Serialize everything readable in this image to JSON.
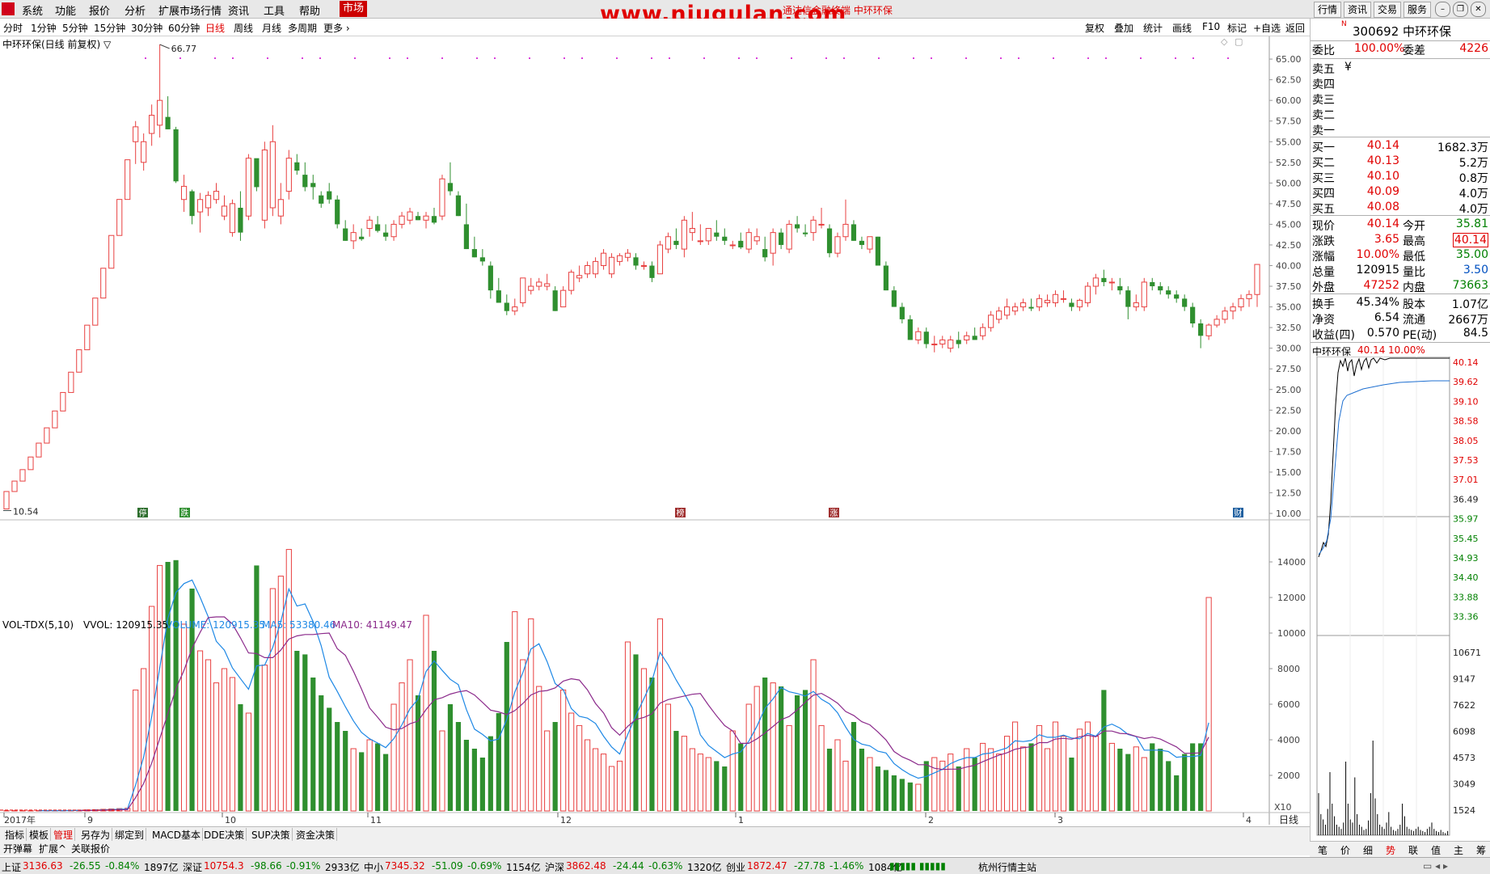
{
  "menu": {
    "items": [
      "系统",
      "功能",
      "报价",
      "分析",
      "扩展市场行情",
      "资讯",
      "工具",
      "帮助"
    ],
    "market_tab": "市场",
    "watermark": "www.niugulan.com",
    "ticker_overlay": "通达信金融终端 中环环保",
    "right_buttons": [
      "行情",
      "资讯",
      "交易",
      "服务"
    ]
  },
  "periods": {
    "items": [
      "分时",
      "1分钟",
      "5分钟",
      "15分钟",
      "30分钟",
      "60分钟",
      "日线",
      "周线",
      "月线",
      "多周期",
      "更多"
    ],
    "selected": "日线",
    "right_items": [
      "复权",
      "叠加",
      "统计",
      "画线",
      "F10",
      "标记",
      "+自选",
      "返回"
    ]
  },
  "chart": {
    "title": "中环环保(日线 前复权) ▽",
    "max_label": "66.77",
    "min_label": "10.54",
    "price_ticks": [
      "65.00",
      "62.50",
      "60.00",
      "57.50",
      "55.00",
      "52.50",
      "50.00",
      "47.50",
      "45.00",
      "42.50",
      "40.00",
      "37.50",
      "35.00",
      "32.50",
      "30.00",
      "27.50",
      "25.00",
      "22.50",
      "20.00",
      "17.50",
      "15.00",
      "12.50",
      "10.00"
    ],
    "event_markers": [
      "停",
      "跌",
      "榜",
      "涨",
      "财"
    ],
    "vol_header": {
      "name": "VOL-TDX(5,10)",
      "vvol": "VVOL: 120915.35",
      "volume": "VOLUME: 120915.35",
      "ma5": "MA5: 53380.46",
      "ma10": "MA10: 41149.47"
    },
    "vol_ticks": [
      "14000",
      "12000",
      "10000",
      "8000",
      "6000",
      "4000",
      "2000"
    ],
    "vol_unit": "X10",
    "date_labels": [
      "2017年",
      "9",
      "10",
      "11",
      "12",
      "1",
      "2",
      "3",
      "4"
    ],
    "period_label": "日线",
    "colors": {
      "up": "#e84040",
      "down": "#2f8f2f",
      "ma5": "#1e88e5",
      "ma10": "#8b2a8b"
    }
  },
  "chart_data": {
    "type": "candlestick",
    "ylim": [
      10.0,
      66.77
    ],
    "candles": [
      [
        10.54,
        12.0,
        10.54,
        12.65
      ],
      [
        12.65,
        13.91,
        12.65,
        13.91
      ],
      [
        13.91,
        15.3,
        13.91,
        15.3
      ],
      [
        15.3,
        16.83,
        15.3,
        16.83
      ],
      [
        16.83,
        18.51,
        16.83,
        18.51
      ],
      [
        18.51,
        20.36,
        18.51,
        20.36
      ],
      [
        20.36,
        22.4,
        20.36,
        22.4
      ],
      [
        22.4,
        24.64,
        22.4,
        24.64
      ],
      [
        24.64,
        27.1,
        24.64,
        27.1
      ],
      [
        27.1,
        29.81,
        27.1,
        29.81
      ],
      [
        29.81,
        32.79,
        29.81,
        32.79
      ],
      [
        32.79,
        36.07,
        32.79,
        36.07
      ],
      [
        36.07,
        39.68,
        36.07,
        39.68
      ],
      [
        39.68,
        43.65,
        39.68,
        43.65
      ],
      [
        43.65,
        48.01,
        43.65,
        48.01
      ],
      [
        48.01,
        52.81,
        48.01,
        52.81
      ],
      [
        55.0,
        57.5,
        52.3,
        56.8
      ],
      [
        52.5,
        56.0,
        51.5,
        55.0
      ],
      [
        56.0,
        59.5,
        54.5,
        58.2
      ],
      [
        57.0,
        66.77,
        55.5,
        60.0
      ],
      [
        58.0,
        60.5,
        56.5,
        56.5
      ],
      [
        56.5,
        56.8,
        50.0,
        50.2
      ],
      [
        48.0,
        51.0,
        46.5,
        49.6
      ],
      [
        49.0,
        49.2,
        45.0,
        46.0
      ],
      [
        46.5,
        48.8,
        44.0,
        48.0
      ],
      [
        47.0,
        49.0,
        46.0,
        48.5
      ],
      [
        48.0,
        50.0,
        47.5,
        49.0
      ],
      [
        46.0,
        48.5,
        45.5,
        47.2
      ],
      [
        44.0,
        48.0,
        43.5,
        47.5
      ],
      [
        47.0,
        49.0,
        43.0,
        44.0
      ],
      [
        46.0,
        53.5,
        45.5,
        53.0
      ],
      [
        53.0,
        52.5,
        49.0,
        49.5
      ],
      [
        45.5,
        55.0,
        44.5,
        54.0
      ],
      [
        47.0,
        57.0,
        46.0,
        55.0
      ],
      [
        46.0,
        50.0,
        45.0,
        48.0
      ],
      [
        49.0,
        54.0,
        48.0,
        53.0
      ],
      [
        52.5,
        53.5,
        51.0,
        51.5
      ],
      [
        51.0,
        52.5,
        49.0,
        49.5
      ],
      [
        50.0,
        51.0,
        48.0,
        49.5
      ],
      [
        48.5,
        49.0,
        47.0,
        47.5
      ],
      [
        49.0,
        50.0,
        47.5,
        48.0
      ],
      [
        48.0,
        48.5,
        44.5,
        45.0
      ],
      [
        44.5,
        45.5,
        43.0,
        43.0
      ],
      [
        43.0,
        45.0,
        42.0,
        44.0
      ],
      [
        43.5,
        44.5,
        43.0,
        43.2
      ],
      [
        44.5,
        46.0,
        43.5,
        45.5
      ],
      [
        45.0,
        46.0,
        44.0,
        44.2
      ],
      [
        44.0,
        45.0,
        43.0,
        43.5
      ],
      [
        43.5,
        45.5,
        43.0,
        45.0
      ],
      [
        45.0,
        46.5,
        44.5,
        46.0
      ],
      [
        45.5,
        47.0,
        45.0,
        46.5
      ],
      [
        46.0,
        46.5,
        45.5,
        45.5
      ],
      [
        45.5,
        46.5,
        44.5,
        46.0
      ],
      [
        46.0,
        47.0,
        45.0,
        45.2
      ],
      [
        46.0,
        51.0,
        45.5,
        50.5
      ],
      [
        50.0,
        52.5,
        48.5,
        49.0
      ],
      [
        48.5,
        49.0,
        46.0,
        46.0
      ],
      [
        45.0,
        47.5,
        42.0,
        42.0
      ],
      [
        42.0,
        43.5,
        41.0,
        41.0
      ],
      [
        41.0,
        42.0,
        40.0,
        40.5
      ],
      [
        40.0,
        40.5,
        36.0,
        37.0
      ],
      [
        37.0,
        38.5,
        35.5,
        35.5
      ],
      [
        35.5,
        36.5,
        34.0,
        34.5
      ],
      [
        34.5,
        36.0,
        34.0,
        35.0
      ],
      [
        35.5,
        38.5,
        35.0,
        38.5
      ],
      [
        37.0,
        38.5,
        36.5,
        37.5
      ],
      [
        37.5,
        38.5,
        37.0,
        38.0
      ],
      [
        37.5,
        39.0,
        37.0,
        37.8
      ],
      [
        37.0,
        37.5,
        34.5,
        34.5
      ],
      [
        35.0,
        37.5,
        35.0,
        37.0
      ],
      [
        37.0,
        39.5,
        36.5,
        39.2
      ],
      [
        38.5,
        40.0,
        38.0,
        38.8
      ],
      [
        39.0,
        40.5,
        38.5,
        40.0
      ],
      [
        39.0,
        41.0,
        38.5,
        40.5
      ],
      [
        40.0,
        42.0,
        39.5,
        41.5
      ],
      [
        39.0,
        41.5,
        38.5,
        41.0
      ],
      [
        40.5,
        41.5,
        40.0,
        41.2
      ],
      [
        41.0,
        42.0,
        40.5,
        41.5
      ],
      [
        41.0,
        41.5,
        39.5,
        40.0
      ],
      [
        40.0,
        40.5,
        39.5,
        40.0
      ],
      [
        40.0,
        40.5,
        38.0,
        38.5
      ],
      [
        39.0,
        43.0,
        39.0,
        42.5
      ],
      [
        42.0,
        44.0,
        41.5,
        43.5
      ],
      [
        43.0,
        44.5,
        42.0,
        42.5
      ],
      [
        42.0,
        46.0,
        41.0,
        45.5
      ],
      [
        44.0,
        46.5,
        43.0,
        44.5
      ],
      [
        43.0,
        45.0,
        42.5,
        43.0
      ],
      [
        43.0,
        44.5,
        42.5,
        44.5
      ],
      [
        44.0,
        45.5,
        43.0,
        43.5
      ],
      [
        43.5,
        44.5,
        42.5,
        43.0
      ],
      [
        42.5,
        43.0,
        42.0,
        42.5
      ],
      [
        43.0,
        44.0,
        42.0,
        42.2
      ],
      [
        42.0,
        44.5,
        41.5,
        44.0
      ],
      [
        43.0,
        44.5,
        42.5,
        43.5
      ],
      [
        42.0,
        43.5,
        40.5,
        41.0
      ],
      [
        41.5,
        44.5,
        40.0,
        44.0
      ],
      [
        44.0,
        44.5,
        42.0,
        42.5
      ],
      [
        42.0,
        45.5,
        41.5,
        45.0
      ],
      [
        45.0,
        46.0,
        44.0,
        44.5
      ],
      [
        44.0,
        45.0,
        43.5,
        43.8
      ],
      [
        44.0,
        46.0,
        43.0,
        45.5
      ],
      [
        45.0,
        47.0,
        44.5,
        45.0
      ],
      [
        44.5,
        45.0,
        41.0,
        41.5
      ],
      [
        41.5,
        44.0,
        41.0,
        43.5
      ],
      [
        43.5,
        48.0,
        43.0,
        45.0
      ],
      [
        45.0,
        45.5,
        43.0,
        43.0
      ],
      [
        43.0,
        43.5,
        42.0,
        42.5
      ],
      [
        42.0,
        43.5,
        41.5,
        43.5
      ],
      [
        43.5,
        43.5,
        40.0,
        40.0
      ],
      [
        40.0,
        40.5,
        37.0,
        37.0
      ],
      [
        37.0,
        37.5,
        35.0,
        35.0
      ],
      [
        35.0,
        35.5,
        33.0,
        33.5
      ],
      [
        33.5,
        34.0,
        31.0,
        31.0
      ],
      [
        31.0,
        32.5,
        30.5,
        32.0
      ],
      [
        32.0,
        32.5,
        30.0,
        30.5
      ],
      [
        30.5,
        31.5,
        29.5,
        30.5
      ],
      [
        30.5,
        31.5,
        30.0,
        31.0
      ],
      [
        30.0,
        31.5,
        29.5,
        31.0
      ],
      [
        31.0,
        32.0,
        30.0,
        30.5
      ],
      [
        31.0,
        32.0,
        30.5,
        31.5
      ],
      [
        31.5,
        32.5,
        31.0,
        31.0
      ],
      [
        31.5,
        33.0,
        31.0,
        32.5
      ],
      [
        32.5,
        34.5,
        32.0,
        34.0
      ],
      [
        33.5,
        35.0,
        33.0,
        34.5
      ],
      [
        34.0,
        36.0,
        33.5,
        35.0
      ],
      [
        34.5,
        35.5,
        34.0,
        35.0
      ],
      [
        35.0,
        36.0,
        34.5,
        35.5
      ],
      [
        35.0,
        36.0,
        34.5,
        34.8
      ],
      [
        35.0,
        36.5,
        34.5,
        36.0
      ],
      [
        35.5,
        36.5,
        35.0,
        35.8
      ],
      [
        35.5,
        37.0,
        35.0,
        36.5
      ],
      [
        36.0,
        37.0,
        35.5,
        36.0
      ],
      [
        35.5,
        36.0,
        34.5,
        35.0
      ],
      [
        35.0,
        36.0,
        34.5,
        35.8
      ],
      [
        35.5,
        38.0,
        35.0,
        37.5
      ],
      [
        37.5,
        39.0,
        36.5,
        38.5
      ],
      [
        38.5,
        39.5,
        37.5,
        38.0
      ],
      [
        38.0,
        38.5,
        37.0,
        38.0
      ],
      [
        37.5,
        38.5,
        36.5,
        37.0
      ],
      [
        37.0,
        37.5,
        33.5,
        35.0
      ],
      [
        35.0,
        36.5,
        34.5,
        35.5
      ],
      [
        35.0,
        38.5,
        34.5,
        38.0
      ],
      [
        38.0,
        38.5,
        37.0,
        37.5
      ],
      [
        37.5,
        38.0,
        36.5,
        37.0
      ],
      [
        37.0,
        37.5,
        36.0,
        36.5
      ],
      [
        36.5,
        37.0,
        35.5,
        36.0
      ],
      [
        36.0,
        36.5,
        34.5,
        35.0
      ],
      [
        35.0,
        35.5,
        32.5,
        33.0
      ],
      [
        33.0,
        33.5,
        30.0,
        31.5
      ],
      [
        31.5,
        33.0,
        31.0,
        32.8
      ],
      [
        32.8,
        34.0,
        32.5,
        33.5
      ],
      [
        33.5,
        35.0,
        33.0,
        34.5
      ],
      [
        34.5,
        35.5,
        33.5,
        35.0
      ],
      [
        35.0,
        36.5,
        34.5,
        36.0
      ],
      [
        36.0,
        37.0,
        35.0,
        36.5
      ],
      [
        36.5,
        40.14,
        35.0,
        40.14
      ]
    ],
    "volumes": [
      20,
      20,
      20,
      20,
      20,
      20,
      20,
      20,
      30,
      40,
      60,
      70,
      90,
      110,
      130,
      150,
      6800,
      8000,
      11500,
      13800,
      14000,
      14100,
      10500,
      12500,
      9000,
      8500,
      7200,
      8000,
      7500,
      6000,
      5500,
      13800,
      8200,
      12500,
      13200,
      14700,
      9000,
      8800,
      7500,
      6500,
      5800,
      5000,
      4500,
      3500,
      3300,
      4000,
      3800,
      3200,
      6000,
      7200,
      8500,
      6500,
      11000,
      9000,
      4500,
      6000,
      5000,
      4000,
      3500,
      3000,
      4200,
      5500,
      9500,
      11200,
      8500,
      10800,
      7000,
      4500,
      5000,
      6800,
      5500,
      4800,
      4000,
      3500,
      3200,
      2500,
      2800,
      9500,
      8800,
      8000,
      7500,
      10800,
      6000,
      4500,
      4200,
      3500,
      3200,
      3000,
      2800,
      2500,
      4500,
      3800,
      6000,
      7000,
      7500,
      7200,
      7000,
      4800,
      6500,
      6800,
      8500,
      4800,
      3500,
      4000,
      2800,
      5000,
      3500,
      3000,
      2500,
      2300,
      2000,
      1800,
      1600,
      1500,
      2800,
      3000,
      2800,
      3200,
      2500,
      3500,
      3000,
      3800,
      3500,
      3200,
      4200,
      5000,
      3600,
      3800,
      4800,
      3500,
      5000,
      4200,
      3000,
      4600,
      5000,
      4200,
      6800,
      3800,
      3500,
      3200,
      3600,
      3000,
      3800,
      3500,
      2800,
      2000,
      3200,
      3800,
      3800,
      12000
    ]
  },
  "right_panel": {
    "code_name": "300692 中环环保",
    "weibi_label": "委比",
    "weibi": "100.00%",
    "weicha_label": "委差",
    "weicha": "4226",
    "sells": [
      {
        "label": "卖五",
        "price": "¥",
        "vol": ""
      },
      {
        "label": "卖四",
        "price": "",
        "vol": ""
      },
      {
        "label": "卖三",
        "price": "",
        "vol": ""
      },
      {
        "label": "卖二",
        "price": "",
        "vol": ""
      },
      {
        "label": "卖一",
        "price": "",
        "vol": ""
      }
    ],
    "buys": [
      {
        "label": "买一",
        "price": "40.14",
        "vol": "1682.3万"
      },
      {
        "label": "买二",
        "price": "40.13",
        "vol": "5.2万"
      },
      {
        "label": "买三",
        "price": "40.10",
        "vol": "0.8万"
      },
      {
        "label": "买四",
        "price": "40.09",
        "vol": "4.0万"
      },
      {
        "label": "买五",
        "price": "40.08",
        "vol": "4.0万"
      }
    ],
    "quote": [
      {
        "l1": "现价",
        "v1": "40.14",
        "l2": "今开",
        "v2": "35.81",
        "c1": "red",
        "c2": "green"
      },
      {
        "l1": "涨跌",
        "v1": "3.65",
        "l2": "最高",
        "v2": "40.14",
        "c1": "red",
        "c2": "red-box"
      },
      {
        "l1": "涨幅",
        "v1": "10.00%",
        "l2": "最低",
        "v2": "35.00",
        "c1": "red",
        "c2": "green"
      },
      {
        "l1": "总量",
        "v1": "120915",
        "l2": "量比",
        "v2": "3.50",
        "c1": "black",
        "c2": "blue"
      },
      {
        "l1": "外盘",
        "v1": "47252",
        "l2": "内盘",
        "v2": "73663",
        "c1": "red",
        "c2": "green"
      }
    ],
    "fund": [
      {
        "l1": "换手",
        "v1": "45.34%",
        "l2": "股本",
        "v2": "1.07亿"
      },
      {
        "l1": "净资",
        "v1": "6.54",
        "l2": "流通",
        "v2": "2667万"
      },
      {
        "l1": "收益(四)",
        "v1": "0.570",
        "l2": "PE(动)",
        "v2": "84.5"
      }
    ],
    "mini": {
      "title": "中环环保",
      "price": "40.14",
      "pct": "10.00%",
      "price_ticks": [
        "40.14",
        "39.62",
        "39.10",
        "38.58",
        "38.05",
        "37.53",
        "37.01",
        "36.49",
        "35.97",
        "35.45",
        "34.93",
        "34.40",
        "33.88",
        "33.36"
      ],
      "vol_ticks": [
        "10671",
        "9147",
        "7622",
        "6098",
        "4573",
        "3049",
        "1524"
      ]
    },
    "tabs": [
      "笔",
      "价",
      "细",
      "势",
      "联",
      "值",
      "主",
      "筹"
    ]
  },
  "bottom": {
    "tabs1": [
      "指标",
      "模板",
      "管理",
      "另存为",
      "绑定到",
      "MACD基本",
      "DDE决策",
      "SUP决策",
      "资金决策"
    ],
    "tabs2": [
      "开弹幕",
      "扩展^",
      "关联报价"
    ]
  },
  "status": {
    "items": [
      {
        "name": "上证",
        "val": "3136.63",
        "chg": "-26.55",
        "pct": "-0.84%",
        "amt": "1897亿"
      },
      {
        "name": "深证",
        "val": "10754.3",
        "chg": "-98.66",
        "pct": "-0.91%",
        "amt": "2933亿"
      },
      {
        "name": "中小",
        "val": "7345.32",
        "chg": "-51.09",
        "pct": "-0.69%",
        "amt": "1154亿"
      },
      {
        "name": "沪深",
        "val": "3862.48",
        "chg": "-24.44",
        "pct": "-0.63%",
        "amt": "1320亿"
      },
      {
        "name": "创业",
        "val": "1872.47",
        "chg": "-27.78",
        "pct": "-1.46%",
        "amt": "1084亿"
      }
    ],
    "server": "杭州行情主站"
  }
}
